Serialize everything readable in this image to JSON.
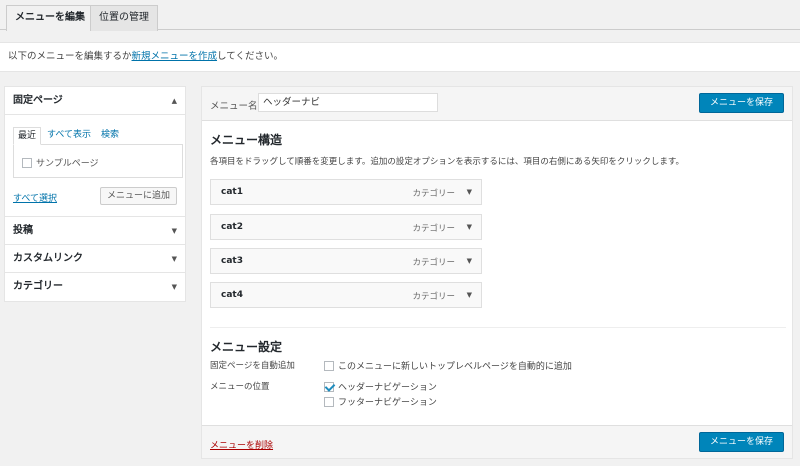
{
  "tabs": [
    {
      "label": "メニューを編集"
    },
    {
      "label": "位置の管理"
    }
  ],
  "notice": {
    "before": "以下のメニューを編集するか",
    "link": "新規メニューを作成",
    "after": "してください。"
  },
  "sidebar": {
    "pages": {
      "title": "固定ページ",
      "tabs": [
        "最近",
        "すべて表示",
        "検索"
      ],
      "items": [
        {
          "label": "サンプルページ",
          "checked": false
        }
      ],
      "select_all": "すべて選択",
      "add_button": "メニューに追加"
    },
    "sections": [
      {
        "title": "投稿"
      },
      {
        "title": "カスタムリンク"
      },
      {
        "title": "カテゴリー"
      }
    ]
  },
  "menu": {
    "name_label": "メニュー名",
    "name_value": "ヘッダーナビ",
    "save_label": "メニューを保存",
    "structure_title": "メニュー構造",
    "structure_desc": "各項目をドラッグして順番を変更します。追加の設定オプションを表示するには、項目の右側にある矢印をクリックします。",
    "items": [
      {
        "name": "cat1",
        "type": "カテゴリー"
      },
      {
        "name": "cat2",
        "type": "カテゴリー"
      },
      {
        "name": "cat3",
        "type": "カテゴリー"
      },
      {
        "name": "cat4",
        "type": "カテゴリー"
      }
    ],
    "settings_title": "メニュー設定",
    "auto_add_label": "固定ページを自動追加",
    "auto_add_option": "このメニューに新しいトップレベルページを自動的に追加",
    "location_label": "メニューの位置",
    "locations": [
      {
        "label": "ヘッダーナビゲーション",
        "checked": true
      },
      {
        "label": "フッターナビゲーション",
        "checked": false
      }
    ],
    "delete_label": "メニューを削除"
  },
  "colors": {
    "primary": "#0085ba",
    "link": "#0073aa",
    "delete": "#aa0000"
  }
}
